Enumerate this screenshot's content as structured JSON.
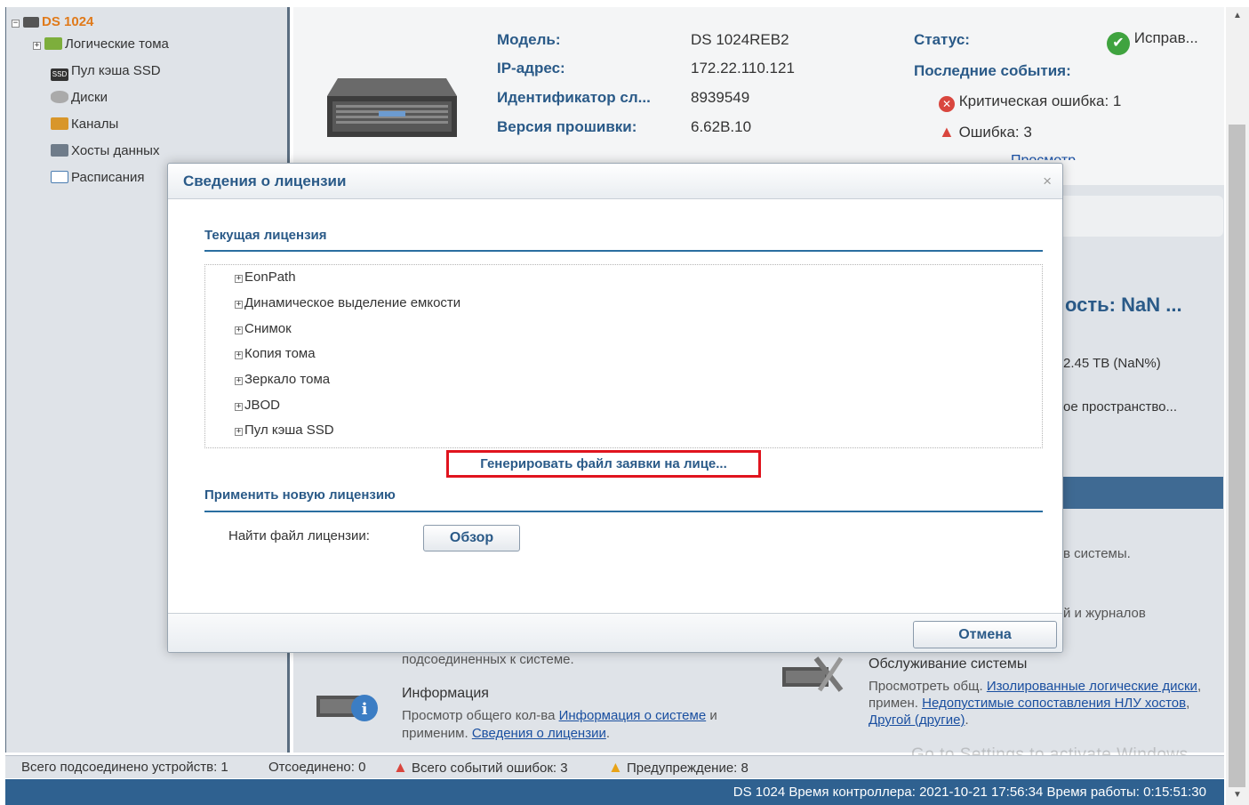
{
  "sidebar": {
    "root": "DS 1024",
    "items": [
      {
        "label": "Логические тома",
        "icon": "volume-icon"
      },
      {
        "label": "Пул кэша SSD",
        "icon": "ssd-icon"
      },
      {
        "label": "Диски",
        "icon": "disk-icon"
      },
      {
        "label": "Каналы",
        "icon": "channel-icon"
      },
      {
        "label": "Хосты данных",
        "icon": "host-icon"
      },
      {
        "label": "Расписания",
        "icon": "schedule-icon"
      }
    ]
  },
  "info": {
    "model_label": "Модель:",
    "model_value": "DS 1024REB2",
    "ip_label": "IP-адрес:",
    "ip_value": "172.22.110.121",
    "id_label": "Идентификатор сл...",
    "id_value": "8939549",
    "fw_label": "Версия прошивки:",
    "fw_value": "6.62B.10",
    "status_label": "Статус:",
    "status_value": "Исправ...",
    "events_label": "Последние события:",
    "critical": "Критическая ошибка: 1",
    "error": "Ошибка: 3",
    "view_link": "Просмотр..."
  },
  "right_partial": {
    "capacity": "ость: NaN ...",
    "tb": "2.45 TB (NaN%)",
    "space": "ое пространство...",
    "sys": "в системы.",
    "logs": "й и журналов"
  },
  "bottom": {
    "connected_text": "подсоединенных к системе.",
    "info_title": "Информация",
    "info_desc1": "Просмотр общего кол-ва ",
    "info_link1": "Информация о системе",
    "info_desc2": " и применим. ",
    "info_link2": "Сведения о лицензии",
    "maint_title": "Обслуживание системы",
    "maint_desc1": "Просмотреть общ. ",
    "maint_link1": "Изолированные логические диски",
    "maint_desc2": ", примен. ",
    "maint_link2": "Недопустимые сопоставления НЛУ хостов",
    "maint_desc3": ", ",
    "maint_link3": "Другой (другие)",
    "maint_end": ".",
    "watermark": "Go to Settings to activate Windows."
  },
  "statusbar": {
    "connected": "Всего подсоединено устройств: 1",
    "disconnected": "Отсоединено: 0",
    "error_events": "Всего событий ошибок: 3",
    "warnings": "Предупреждение: 8",
    "controller": "DS 1024  Время контроллера: 2021-10-21 17:56:34  Время работы: 0:15:51:30"
  },
  "dialog": {
    "title": "Сведения о лицензии",
    "close": "×",
    "current_title": "Текущая лицензия",
    "licenses": [
      "EonPath",
      "Динамическое выделение емкости",
      "Снимок",
      "Копия тома",
      "Зеркало тома",
      "JBOD",
      "Пул кэша SSD"
    ],
    "generate_button": "Генерировать файл заявки на лице...",
    "apply_title": "Применить новую лицензию",
    "find_label": "Найти файл лицензии:",
    "browse_button": "Обзор",
    "cancel_button": "Отмена"
  },
  "colors": {
    "accent": "#2a5a88",
    "highlight": "#e0141e",
    "statusbar": "#2f6190"
  }
}
